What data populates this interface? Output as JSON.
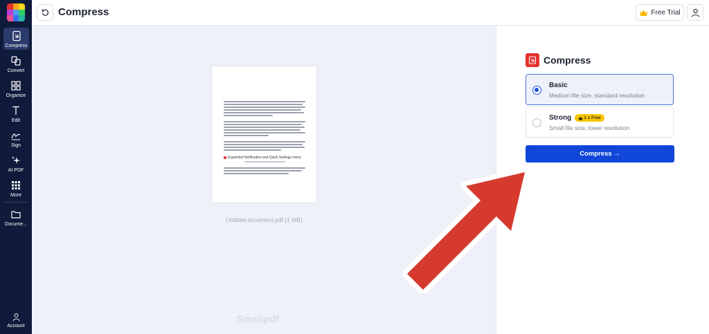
{
  "header": {
    "title": "Compress",
    "trial_label": "Free Trial"
  },
  "sidebar": {
    "items": [
      {
        "label": "Compress",
        "icon": "compress-icon",
        "active": true
      },
      {
        "label": "Convert",
        "icon": "convert-icon"
      },
      {
        "label": "Organize",
        "icon": "organize-icon"
      },
      {
        "label": "Edit",
        "icon": "edit-text-icon"
      },
      {
        "label": "Sign",
        "icon": "sign-icon"
      },
      {
        "label": "AI PDF",
        "icon": "ai-sparkle-icon"
      },
      {
        "label": "More",
        "icon": "grid-icon"
      },
      {
        "label": "Docume...",
        "icon": "folder-icon"
      }
    ],
    "account_label": "Account"
  },
  "preview": {
    "doc_heading": "Expanded Notification and Quick Settings menu",
    "caption": "Untitled document.pdf (1 MB)",
    "watermark": "Smallpdf"
  },
  "panel": {
    "title": "Compress",
    "options": [
      {
        "name": "Basic",
        "desc": "Medium file size, standard resolution",
        "selected": true
      },
      {
        "name": "Strong",
        "desc": "Small file size, lower resolution",
        "badge": "1 x Free",
        "selected": false
      }
    ],
    "button_label": "Compress →"
  },
  "colors": {
    "sidebar": "#101b3b",
    "accent": "#1147d9",
    "brand_red": "#e4322e",
    "badge": "#f8c600",
    "arrow": "#d63a2f"
  }
}
